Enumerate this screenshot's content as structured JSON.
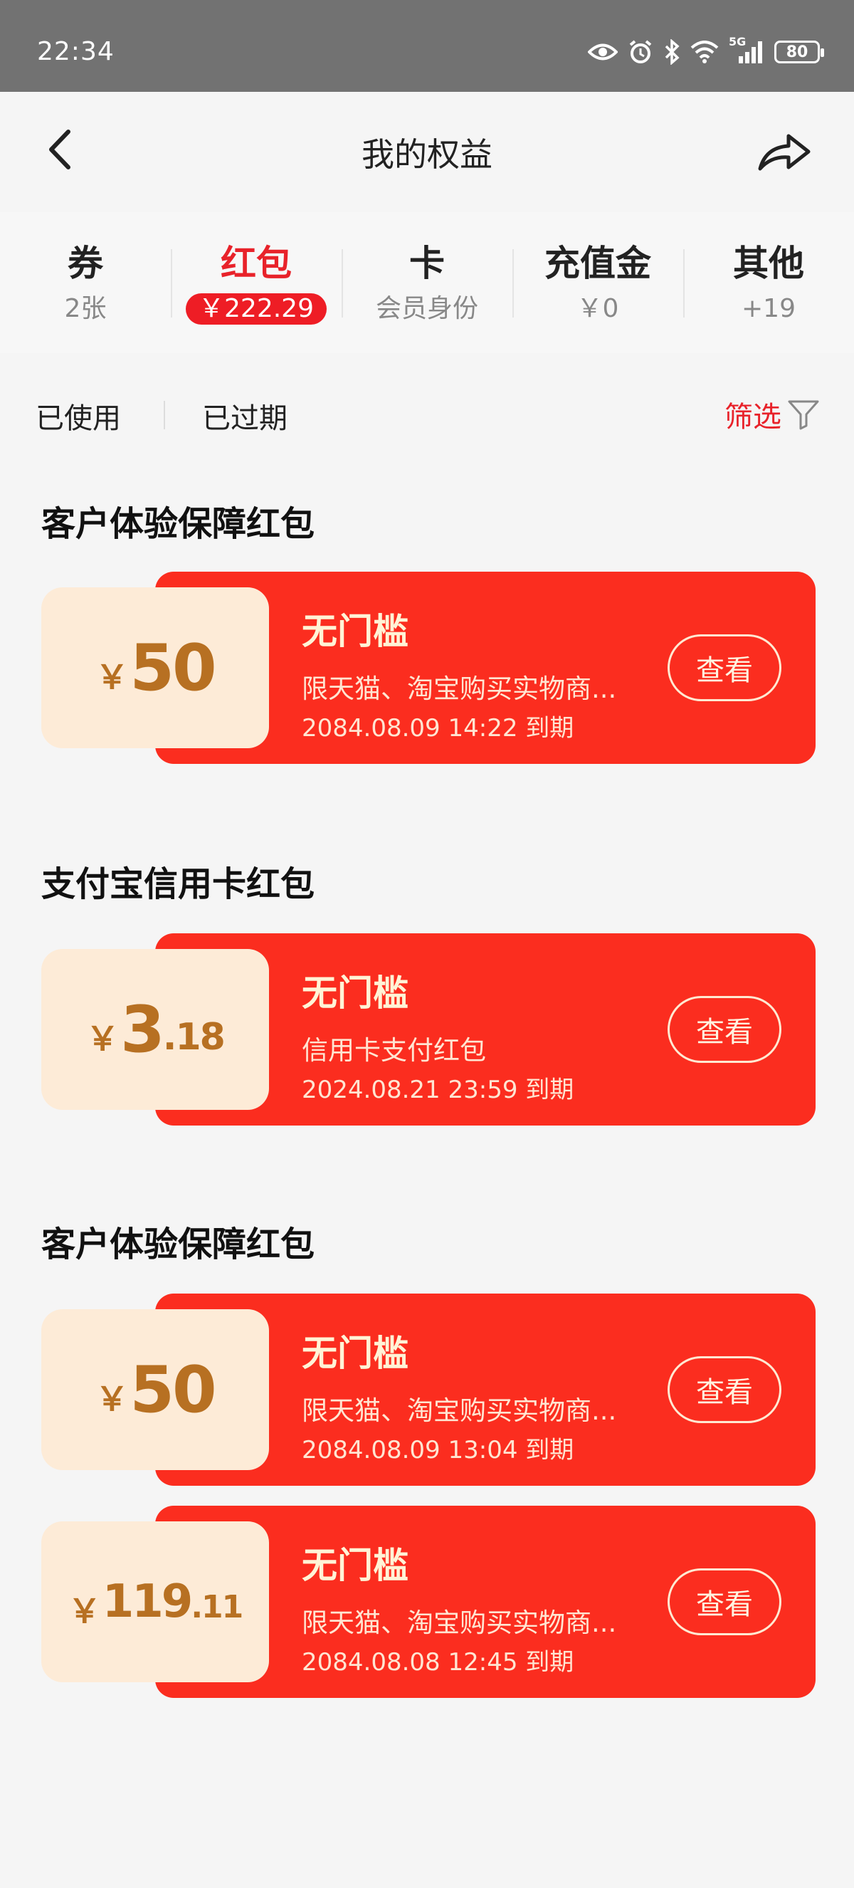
{
  "status_bar": {
    "time": "22:34",
    "network": "5G",
    "battery": "80"
  },
  "header": {
    "title": "我的权益"
  },
  "tabs": [
    {
      "label": "券",
      "sub": "2张"
    },
    {
      "label": "红包",
      "sub": "￥222.29"
    },
    {
      "label": "卡",
      "sub": "会员身份"
    },
    {
      "label": "充值金",
      "sub": "￥0"
    },
    {
      "label": "其他",
      "sub": "+19"
    }
  ],
  "active_tab": "红包",
  "filters": {
    "used": "已使用",
    "expired": "已过期",
    "filter": "筛选"
  },
  "sections": [
    {
      "title": "客户体验保障红包",
      "cards": [
        {
          "currency": "￥",
          "amount_int": "50",
          "amount_dec": "",
          "title": "无门槛",
          "desc": "限天猫、淘宝购买实物商...",
          "expiry": "2084.08.09 14:22 到期",
          "button": "查看"
        }
      ]
    },
    {
      "title": "支付宝信用卡红包",
      "cards": [
        {
          "currency": "￥",
          "amount_int": "3",
          "amount_dec": ".18",
          "title": "无门槛",
          "desc": "信用卡支付红包",
          "expiry": "2024.08.21 23:59 到期",
          "button": "查看"
        }
      ]
    },
    {
      "title": "客户体验保障红包",
      "cards": [
        {
          "currency": "￥",
          "amount_int": "50",
          "amount_dec": "",
          "title": "无门槛",
          "desc": "限天猫、淘宝购买实物商...",
          "expiry": "2084.08.09 13:04 到期",
          "button": "查看"
        },
        {
          "currency": "￥",
          "amount_int": "119",
          "amount_dec": ".11",
          "title": "无门槛",
          "desc": "限天猫、淘宝购买实物商...",
          "expiry": "2084.08.08 12:45 到期",
          "button": "查看"
        }
      ]
    }
  ],
  "colors": {
    "accent_red": "#e8222a",
    "card_red": "#fb2d1f",
    "coupon_bg": "#fdebd7",
    "amount_gold": "#b77022"
  }
}
